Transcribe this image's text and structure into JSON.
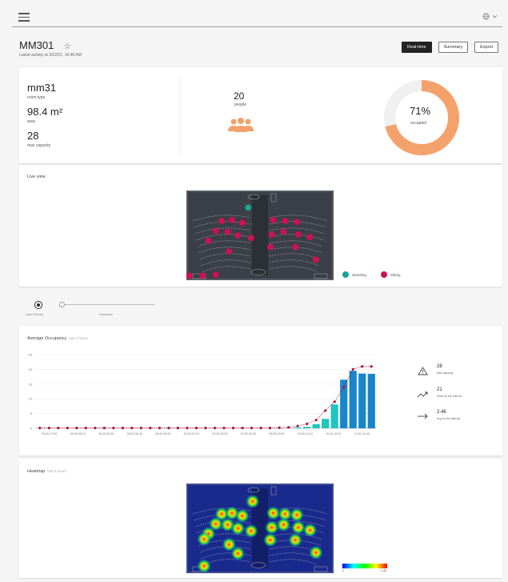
{
  "header": {
    "menu_icon": "hamburger-icon",
    "language_icon": "globe-icon"
  },
  "room": {
    "title": "MM301",
    "latest_activity": "Latest activity at 3/22/21, 10:48 AM"
  },
  "view_buttons": [
    "Real-time",
    "Summary",
    "Export"
  ],
  "stats": {
    "room_type_value": "mm31",
    "room_type_label": "room type",
    "area_value": "98.4 m²",
    "area_label": "area",
    "capacity_value": "28",
    "capacity_label": "max capacity",
    "people_value": "20",
    "people_label": "people",
    "occupied_pct": "71%",
    "occupied_label": "occupied",
    "occupied_fraction": 0.71
  },
  "colors": {
    "accent_orange": "#f4a26b",
    "standing": "#1aa391",
    "sitting": "#cc1155",
    "bar_dark": "#1a86c9",
    "bar_light": "#20c6c0",
    "line": "#a8173f"
  },
  "live_view": {
    "title": "Live view",
    "legend": [
      {
        "label": "Standing"
      },
      {
        "label": "Sitting"
      }
    ],
    "standing_points": [
      [
        0.42,
        0.19
      ]
    ],
    "sitting_points": [
      [
        0.24,
        0.34
      ],
      [
        0.31,
        0.33
      ],
      [
        0.38,
        0.36
      ],
      [
        0.59,
        0.33
      ],
      [
        0.67,
        0.34
      ],
      [
        0.75,
        0.35
      ],
      [
        0.2,
        0.45
      ],
      [
        0.28,
        0.46
      ],
      [
        0.35,
        0.5
      ],
      [
        0.44,
        0.53
      ],
      [
        0.58,
        0.49
      ],
      [
        0.66,
        0.46
      ],
      [
        0.76,
        0.49
      ],
      [
        0.84,
        0.52
      ],
      [
        0.15,
        0.56
      ],
      [
        0.29,
        0.68
      ],
      [
        0.57,
        0.63
      ],
      [
        0.74,
        0.63
      ],
      [
        0.88,
        0.77
      ],
      [
        0.02,
        0.95
      ],
      [
        0.11,
        0.95
      ],
      [
        0.2,
        0.94
      ]
    ]
  },
  "slider": {
    "label_left": "Last 3 hours",
    "label_right": "Overview"
  },
  "chart_data": {
    "type": "bar",
    "title": "Average Occupancy",
    "subtitle": "last 3 hours",
    "categories": [
      "05:00-07:50",
      "06:00-06:10",
      "06:20-06:30",
      "06:30-06:40",
      "06:00-06:20",
      "06:20-03:10",
      "03:20-03:30",
      "03:30-03:40",
      "05:00-03:50",
      "10:00-10:10",
      "10:20-10:22",
      "10:30-10:40"
    ],
    "y_ticks": [
      "20",
      "20",
      "15",
      "10",
      "5",
      "0"
    ],
    "ylim": [
      0,
      25
    ],
    "bars": [
      0,
      0,
      0,
      0,
      0,
      0,
      0,
      0,
      0,
      0,
      0,
      0,
      0,
      0,
      0,
      0,
      0,
      0,
      0,
      0,
      0,
      0,
      0,
      0,
      0,
      0,
      0,
      0,
      0.3,
      0.5,
      1.4,
      3.2,
      8.1,
      16.5,
      19.5,
      18.6,
      18.5
    ],
    "line": [
      0.1,
      0.1,
      0.1,
      0.1,
      0.1,
      0.1,
      0.1,
      0.1,
      0.1,
      0.1,
      0.1,
      0.1,
      0.1,
      0.1,
      0.1,
      0.1,
      0.1,
      0.1,
      0.1,
      0.1,
      0.1,
      0.1,
      0.1,
      0.1,
      0.1,
      0.1,
      0.2,
      0.3,
      0.8,
      1.5,
      2.8,
      6.0,
      9.0,
      14.0,
      20.0,
      21.0,
      21.0
    ]
  },
  "kpis": [
    {
      "value": "28",
      "label": "Max capacity",
      "icon": "warning-icon"
    },
    {
      "value": "21",
      "label": "Peak for the interval",
      "icon": "trend-up-icon"
    },
    {
      "value": "2.46",
      "label": "Avg for the interval",
      "icon": "arrow-right-icon"
    }
  ],
  "heatmap": {
    "title": "Heatmap",
    "subtitle": "last 3 hours",
    "scale_min": "0",
    "scale_max": "1.46",
    "hotspots": [
      [
        0.24,
        0.34
      ],
      [
        0.31,
        0.33
      ],
      [
        0.38,
        0.36
      ],
      [
        0.59,
        0.33
      ],
      [
        0.67,
        0.34
      ],
      [
        0.75,
        0.35
      ],
      [
        0.2,
        0.45
      ],
      [
        0.28,
        0.46
      ],
      [
        0.35,
        0.5
      ],
      [
        0.44,
        0.53
      ],
      [
        0.58,
        0.49
      ],
      [
        0.66,
        0.46
      ],
      [
        0.76,
        0.49
      ],
      [
        0.84,
        0.52
      ],
      [
        0.15,
        0.56
      ],
      [
        0.29,
        0.68
      ],
      [
        0.57,
        0.63
      ],
      [
        0.74,
        0.63
      ],
      [
        0.88,
        0.77
      ],
      [
        0.12,
        0.62
      ],
      [
        0.35,
        0.78
      ],
      [
        0.12,
        0.92
      ],
      [
        0.45,
        0.2
      ]
    ]
  }
}
